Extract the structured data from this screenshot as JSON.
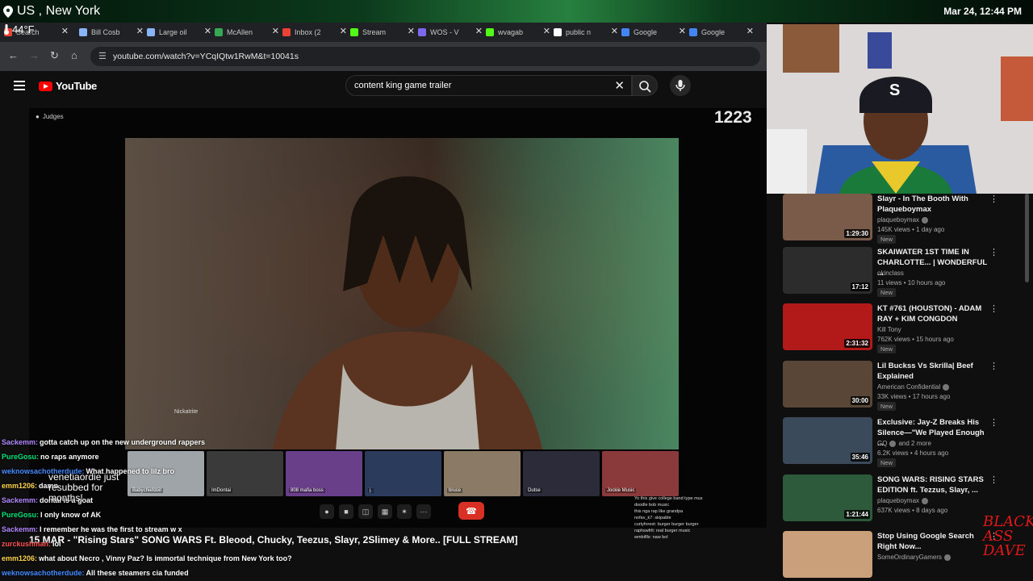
{
  "overlay": {
    "location": "US , New York",
    "datetime": "Mar 24, 12:44 PM",
    "temperature": "44°F"
  },
  "browser": {
    "tabs": [
      {
        "label": "Search",
        "color": "#ea4335"
      },
      {
        "label": "Bill Cosb",
        "color": "#8ab4f8"
      },
      {
        "label": "Large oil",
        "color": "#8ab4f8"
      },
      {
        "label": "McAllen",
        "color": "#34a853"
      },
      {
        "label": "Inbox (2",
        "color": "#ea4335"
      },
      {
        "label": "Stream",
        "color": "#53fc18"
      },
      {
        "label": "WOS - V",
        "color": "#7b68ee"
      },
      {
        "label": "wvagab",
        "color": "#53fc18"
      },
      {
        "label": "public n",
        "color": "#ffffff"
      },
      {
        "label": "Google",
        "color": "#4285f4"
      },
      {
        "label": "Google",
        "color": "#4285f4"
      }
    ],
    "url": "youtube.com/watch?v=YCqIQtw1RwM&t=10041s"
  },
  "youtube": {
    "logo_text": "YouTube",
    "search_query": "content king game trailer"
  },
  "video": {
    "judges_label": "Judges",
    "counter": "1223",
    "nickname": "Nickatrite",
    "participants": [
      {
        "name": "Babychiefdoit",
        "color": "#9fa4a8"
      },
      {
        "name": "ImDontai",
        "color": "#3a3a3a"
      },
      {
        "name": "808 mafia boss",
        "color": "#6a3f8a"
      },
      {
        "name": "j.",
        "color": "#2a3b5c"
      },
      {
        "name": "bruce",
        "color": "#8a7a66"
      },
      {
        "name": "Dutse",
        "color": "#2b2b3a"
      },
      {
        "name": "Jockie Music",
        "color": "#8a3a3a"
      }
    ],
    "mini_chat": [
      "Yo this give college band type mus",
      "doodle bob music",
      "this nga rap like grandpa",
      "nofav_k7: skipable",
      "curtyforest: burger burger burger",
      "raphswfrlt: real burger music",
      "wmbiflls: naw bol"
    ],
    "stream_title": "15 MAR - \"Rising Stars\" SONG WARS Ft. Bleood, Chucky, Teezus, Slayr, 2Slimey & More.. [FULL STREAM]"
  },
  "chat": {
    "sub_notice": "venetiaordie just resubbed for months!",
    "messages": [
      {
        "user": "Sackemm:",
        "text": "gotta catch up on the new underground rappers",
        "color": "#b388ff"
      },
      {
        "user": "PureGosu:",
        "text": "no raps anymore",
        "color": "#00e676"
      },
      {
        "user": "weknowsachotherdude:",
        "text": "What happened to lilz bro",
        "color": "#448aff"
      },
      {
        "user": "emm1206:",
        "text": "damn",
        "color": "#ffd54f"
      },
      {
        "user": "Sackemm:",
        "text": "dontai is a goat",
        "color": "#b388ff"
      },
      {
        "user": "PureGosu:",
        "text": "I only know of AK",
        "color": "#00e676"
      },
      {
        "user": "Sackemm:",
        "text": "I remember he was the first to stream w x",
        "color": "#b388ff"
      },
      {
        "user": "zurckushman:",
        "text": "lol",
        "color": "#ff5252"
      },
      {
        "user": "emm1206:",
        "text": "what about Necro , Vinny Paz? Is immortal technique from New York too?",
        "color": "#ffd54f"
      },
      {
        "user": "weknowsachotherdude:",
        "text": "All these steamers cia funded",
        "color": "#448aff"
      }
    ]
  },
  "sidebar": {
    "items": [
      {
        "title": "Slayr - In The Booth With Plaqueboymax",
        "channel": "plaqueboymax",
        "verified": true,
        "meta": "145K views • 1 day ago",
        "badge": "New",
        "duration": "1:29:30",
        "thumb": "#7a5a48"
      },
      {
        "title": "SKAIWATER 1ST TIME IN CHARLOTTE... | WONDERFUL ...",
        "channel": "okinclass",
        "verified": false,
        "meta": "11 views • 10 hours ago",
        "badge": "New",
        "duration": "17:12",
        "thumb": "#2c2c2c"
      },
      {
        "title": "KT #761 (HOUSTON) - ADAM RAY + KIM CONGDON",
        "channel": "Kill Tony",
        "verified": false,
        "meta": "762K views • 15 hours ago",
        "badge": "New",
        "duration": "2:31:32",
        "thumb": "#b21a1a"
      },
      {
        "title": "Lil Buckss Vs Skrilla| Beef Explained",
        "channel": "American Confidential",
        "verified": true,
        "meta": "33K views • 17 hours ago",
        "badge": "New",
        "duration": "30:00",
        "thumb": "#5a4636"
      },
      {
        "title": "Exclusive: Jay-Z Breaks His Silence—\"We Played Enough ...",
        "channel": "GQ",
        "verified": true,
        "meta": "6.2K views • 4 hours ago",
        "badge": "New",
        "duration": "35:46",
        "thumb": "#3a4a5a",
        "channel_extra": "and 2 more"
      },
      {
        "title": "SONG WARS: RISING STARS EDITION ft. Tezzus, Slayr, ...",
        "channel": "plaqueboymax",
        "verified": true,
        "meta": "637K views • 8 days ago",
        "badge": "",
        "duration": "1:21:44",
        "thumb": "#2d5a3a"
      },
      {
        "title": "Stop Using Google Search Right Now...",
        "channel": "SomeOrdinaryGamers",
        "verified": true,
        "meta": "",
        "badge": "",
        "duration": "",
        "thumb": "#c9a07a"
      }
    ]
  },
  "watermark": "BLACK ASS DAVE"
}
